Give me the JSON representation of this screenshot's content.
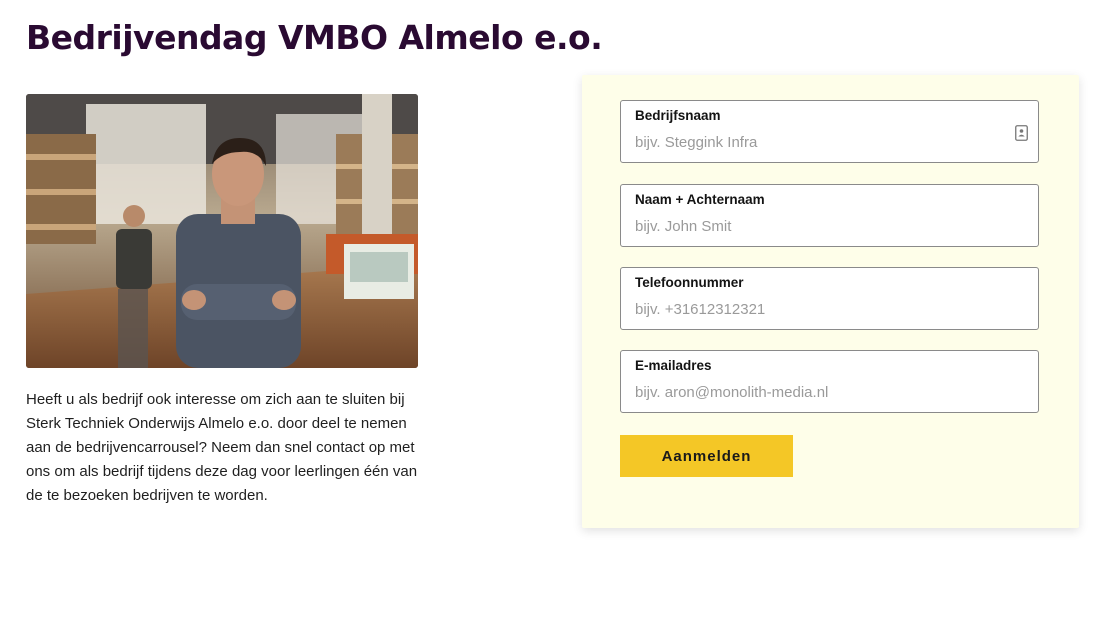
{
  "page": {
    "title": "Bedrijvendag VMBO Almelo e.o.",
    "intro_text": "Heeft u als bedrijf ook interesse om zich aan te sluiten bij Sterk Techniek Onderwijs Almelo e.o. door deel te nemen aan de bedrijvencarrousel? Neem dan snel contact op met ons om als bedrijf tijdens deze dag voor leerlingen één van de te bezoeken bedrijven te worden."
  },
  "form": {
    "fields": [
      {
        "label": "Bedrijfsnaam",
        "placeholder": "bijv. Steggink Infra",
        "value": ""
      },
      {
        "label": "Naam + Achternaam",
        "placeholder": "bijv. John Smit",
        "value": ""
      },
      {
        "label": "Telefoonnummer",
        "placeholder": "bijv. +31612312321",
        "value": ""
      },
      {
        "label": "E-mailadres",
        "placeholder": "bijv. aron@monolith-media.nl",
        "value": ""
      }
    ],
    "submit_label": "Aanmelden",
    "field_icon": "contact-card-icon"
  },
  "colors": {
    "title": "#2a0a32",
    "form_background": "#fefee9",
    "button": "#f4c726"
  }
}
